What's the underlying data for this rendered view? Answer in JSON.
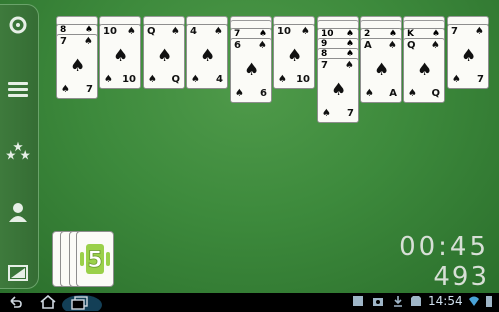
{
  "sidebar": {
    "items": [
      {
        "name": "refresh-icon"
      },
      {
        "name": "menu-icon"
      },
      {
        "name": "stars-icon"
      },
      {
        "name": "profile-icon"
      },
      {
        "name": "theme-icon"
      }
    ]
  },
  "tableau": [
    {
      "backs": 1,
      "peek": {
        "rank": "8",
        "suit": "♠"
      },
      "top": {
        "rank": "7",
        "suit": "♠"
      }
    },
    {
      "backs": 1,
      "top": {
        "rank": "10",
        "suit": "♠"
      }
    },
    {
      "backs": 1,
      "top": {
        "rank": "Q",
        "suit": "♠"
      }
    },
    {
      "backs": 1,
      "top": {
        "rank": "4",
        "suit": "♠"
      }
    },
    {
      "backs": 2,
      "peek": {
        "rank": "7",
        "suit": "♠"
      },
      "top": {
        "rank": "6",
        "suit": "♠"
      }
    },
    {
      "backs": 1,
      "top": {
        "rank": "10",
        "suit": "♠"
      }
    },
    {
      "backs": 2,
      "peeks": [
        {
          "rank": "10",
          "suit": "♠"
        },
        {
          "rank": "9",
          "suit": "♠"
        },
        {
          "rank": "8",
          "suit": "♠"
        }
      ],
      "top": {
        "rank": "7",
        "suit": "♠"
      }
    },
    {
      "backs": 2,
      "peek": {
        "rank": "2",
        "suit": "♠"
      },
      "top": {
        "rank": "A",
        "suit": "♠"
      }
    },
    {
      "backs": 2,
      "peek": {
        "rank": "K",
        "suit": "♠"
      },
      "top": {
        "rank": "Q",
        "suit": "♠"
      }
    },
    {
      "backs": 1,
      "top": {
        "rank": "7",
        "suit": "♠"
      }
    }
  ],
  "stock": {
    "deals_left": "5"
  },
  "hud": {
    "timer": "00:45",
    "score": "493"
  },
  "statusbar": {
    "time": "14:54"
  }
}
